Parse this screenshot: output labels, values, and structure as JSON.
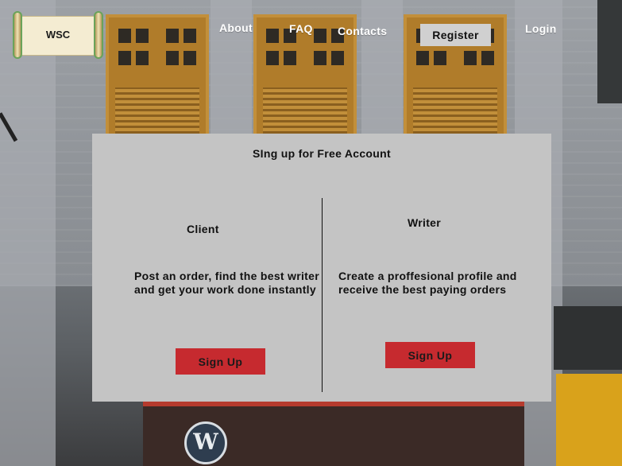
{
  "header": {
    "logo_text": "WSC",
    "nav": {
      "about": "About",
      "faq": "FAQ",
      "contacts": "Contacts",
      "register": "Register",
      "login": "Login"
    }
  },
  "modal": {
    "title": "SIng up for Free Account",
    "client": {
      "title": "Client",
      "desc_line1": "Post an order, find the best writer",
      "desc_line2": "and get your work done instantly",
      "button": "Sign Up"
    },
    "writer": {
      "title": "Writer",
      "desc_line1": "Create a proffesional profile and",
      "desc_line2": "receive the best paying orders",
      "button": "Sign Up"
    }
  },
  "colors": {
    "modal_bg": "#c4c4c4",
    "signup_button": "#c62a2f",
    "register_button": "#d0d0d0"
  }
}
